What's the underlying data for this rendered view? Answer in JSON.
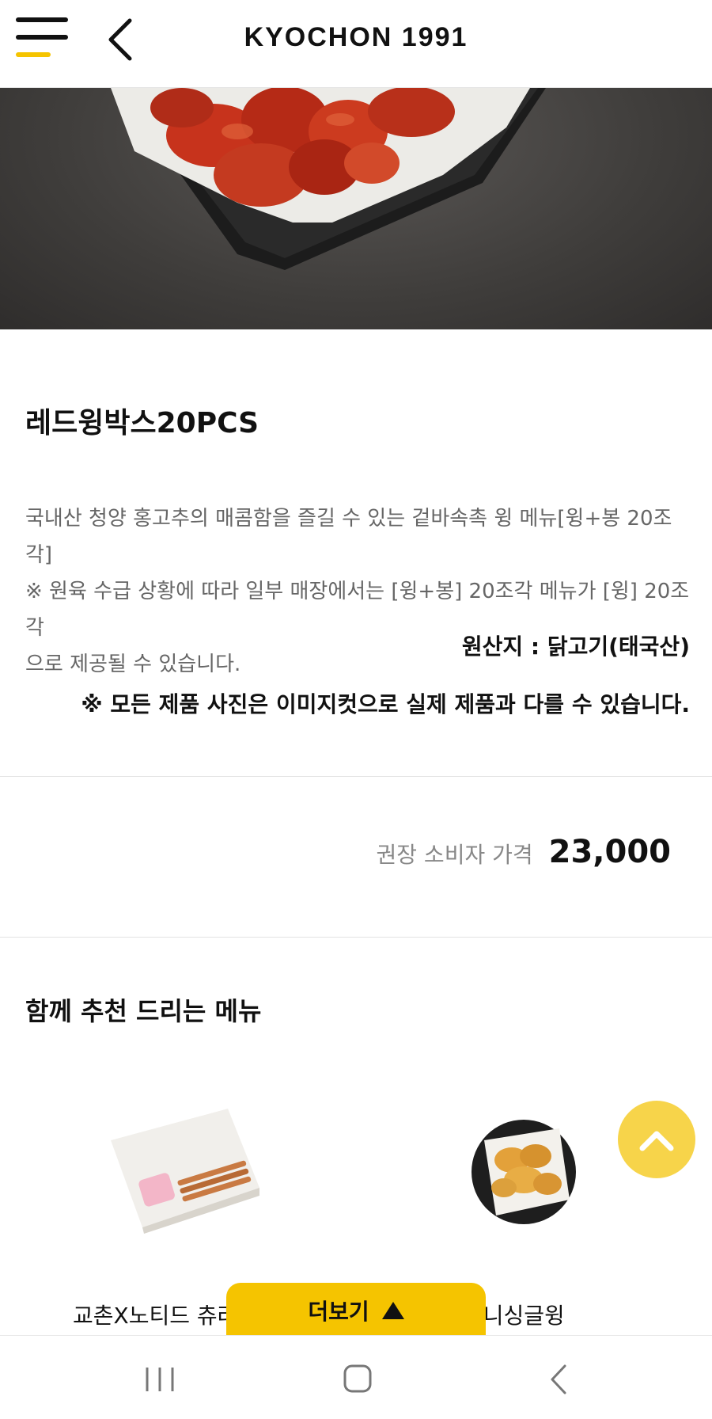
{
  "header": {
    "brand": "KYOCHON 1991",
    "menu_icon": "hamburger-icon",
    "back_icon": "chevron-left-icon"
  },
  "product": {
    "title": "레드윙박스20PCS",
    "description_lines": [
      "국내산 청양 홍고추의 매콤함을 즐길 수 있는 겉바속촉 윙 메뉴[윙+봉 20조각]",
      "※ 원육 수급 상황에 따라 일부 매장에서는 [윙+봉] 20조각 메뉴가 [윙] 20조각",
      "으로 제공될 수 있습니다."
    ],
    "origin": "원산지 : 닭고기(태국산)",
    "photo_note": "※ 모든 제품 사진은 이미지컷으로 실제 제품과 다를 수 있습니다."
  },
  "price": {
    "label": "권장 소비자 가격",
    "value": "23,000"
  },
  "recommend": {
    "title": "함께 추천 드리는 메뉴",
    "items": [
      {
        "label": "교촌X노티드 츄러스"
      },
      {
        "label": "허니싱글윙"
      }
    ]
  },
  "more_button": {
    "label": "더보기",
    "icon": "triangle-up-icon"
  },
  "up_button": {
    "icon": "chevron-up-icon"
  },
  "system_nav": {
    "recent_icon": "recent-apps-icon",
    "home_icon": "home-icon",
    "back_icon": "back-icon"
  },
  "colors": {
    "accent": "#f5c400",
    "up_button": "#f7d44a",
    "muted_text": "#666666"
  }
}
